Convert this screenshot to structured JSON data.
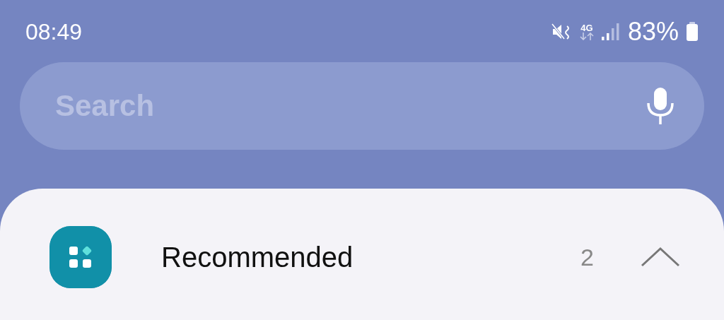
{
  "status_bar": {
    "time": "08:49",
    "network": "4G",
    "battery": "83%"
  },
  "search": {
    "placeholder": "Search"
  },
  "sections": [
    {
      "title": "Recommended",
      "count": "2",
      "expanded": true
    }
  ]
}
